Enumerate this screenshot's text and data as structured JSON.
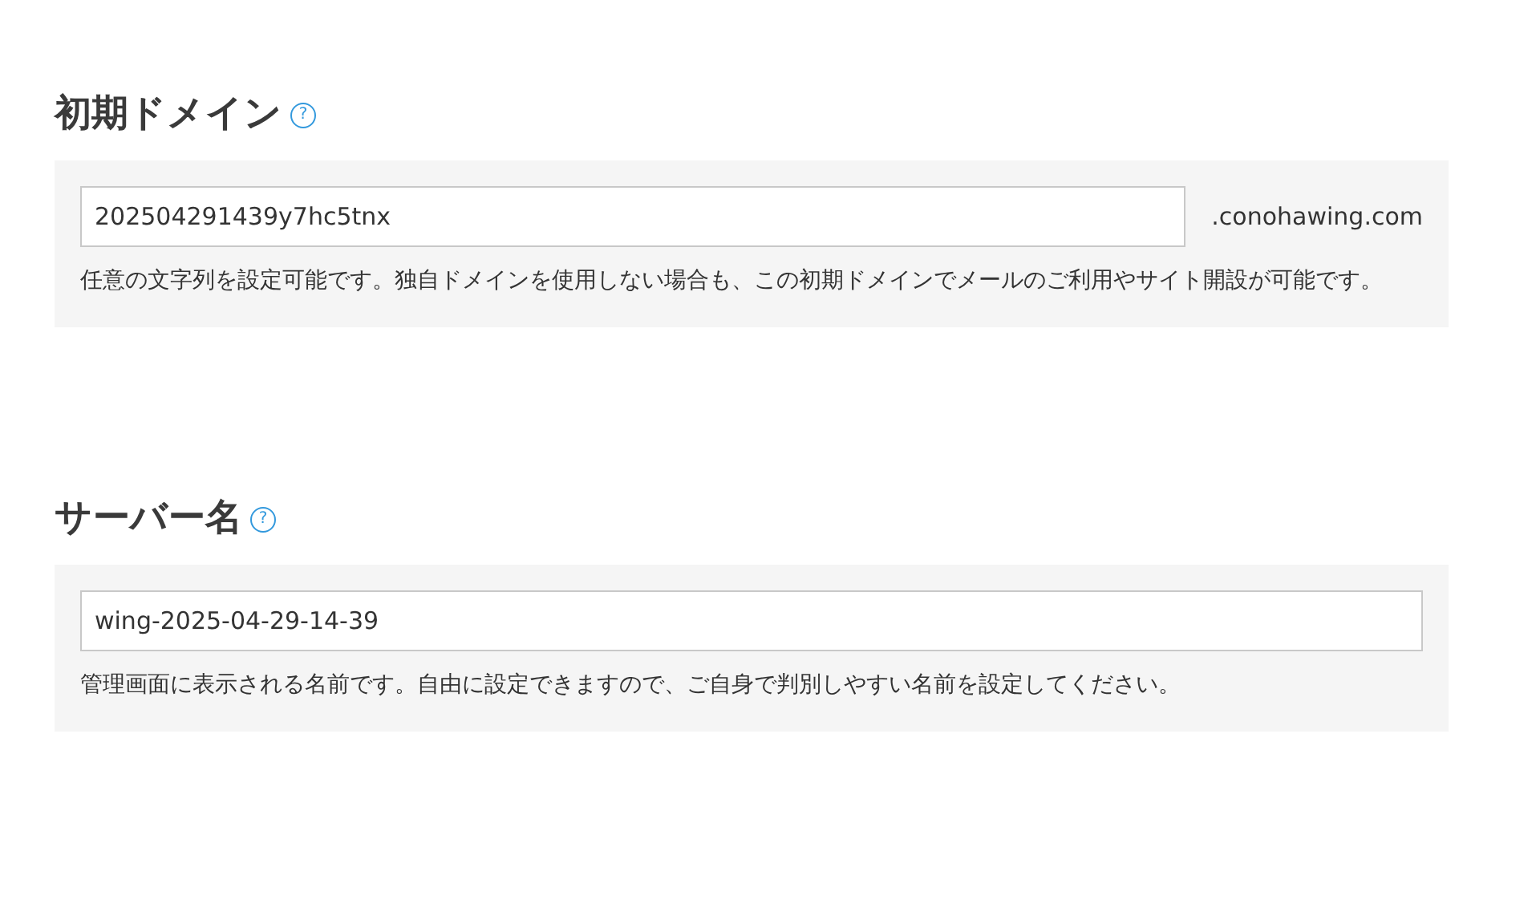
{
  "sections": [
    {
      "title": "初期ドメイン",
      "help": "?",
      "field": {
        "value": "202504291439y7hc5tnx",
        "suffix": ".conohawing.com"
      },
      "description": "任意の文字列を設定可能です。独自ドメインを使用しない場合も、この初期ドメインでメールのご利用やサイト開設が可能です。"
    },
    {
      "title": "サーバー名",
      "help": "?",
      "field": {
        "value": "wing-2025-04-29-14-39"
      },
      "description": "管理画面に表示される名前です。自由に設定できますので、ご自身で判別しやすい名前を設定してください。"
    }
  ]
}
